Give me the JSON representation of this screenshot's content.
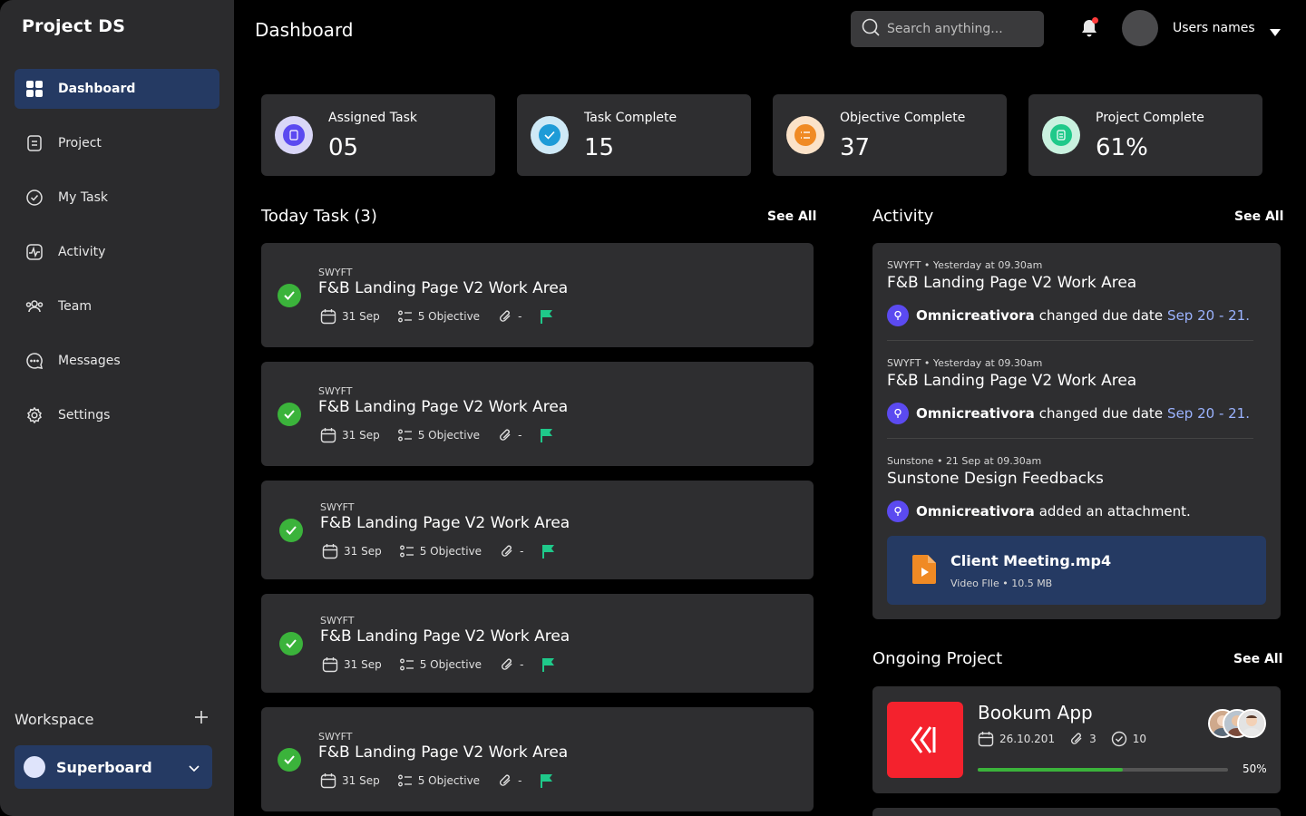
{
  "sidebar": {
    "brand": "Project DS",
    "items": [
      {
        "label": "Dashboard",
        "icon": "grid-icon"
      },
      {
        "label": "Project",
        "icon": "document-icon"
      },
      {
        "label": "My Task",
        "icon": "check-circle-icon"
      },
      {
        "label": "Activity",
        "icon": "activity-icon"
      },
      {
        "label": "Team",
        "icon": "team-icon"
      },
      {
        "label": "Messages",
        "icon": "chat-icon"
      },
      {
        "label": "Settings",
        "icon": "gear-icon"
      }
    ],
    "workspace_label": "Workspace",
    "workspace_name": "Superboard"
  },
  "header": {
    "title": "Dashboard",
    "search_placeholder": "Search anything...",
    "user_name": "Users names"
  },
  "stats": [
    {
      "label": "Assigned Task",
      "value": "05",
      "color": "#5b4af0"
    },
    {
      "label": "Task Complete",
      "value": "15",
      "color": "#1e9bd7"
    },
    {
      "label": "Objective Complete",
      "value": "37",
      "color": "#f08a24"
    },
    {
      "label": "Project Complete",
      "value": "61%",
      "color": "#1fc98a"
    }
  ],
  "today": {
    "title": "Today Task (3)",
    "see_all": "See All",
    "tasks": [
      {
        "company": "SWYFT",
        "title": "F&B Landing Page V2 Work Area",
        "date": "31 Sep",
        "objective": "5 Objective",
        "attach": "-"
      },
      {
        "company": "SWYFT",
        "title": "F&B Landing Page V2 Work Area",
        "date": "31 Sep",
        "objective": "5 Objective",
        "attach": "-"
      },
      {
        "company": "SWYFT",
        "title": "F&B Landing Page V2 Work Area",
        "date": "31 Sep",
        "objective": "5 Objective",
        "attach": "-"
      },
      {
        "company": "SWYFT",
        "title": "F&B Landing Page V2 Work Area",
        "date": "31 Sep",
        "objective": "5 Objective",
        "attach": "-"
      },
      {
        "company": "SWYFT",
        "title": "F&B Landing Page V2 Work Area",
        "date": "31 Sep",
        "objective": "5 Objective",
        "attach": "-"
      }
    ]
  },
  "activity": {
    "title": "Activity",
    "see_all": "See All",
    "entries": [
      {
        "company": "SWYFT",
        "time": "Yesterday at 09.30am",
        "title": "F&B Landing Page V2 Work Area",
        "user": "Omnicreativora",
        "action": "changed due date",
        "date": "Sep 20 - 21."
      },
      {
        "company": "SWYFT",
        "time": "Yesterday at 09.30am",
        "title": "F&B Landing Page V2 Work Area",
        "user": "Omnicreativora",
        "action": "changed due date",
        "date": "Sep 20 - 21."
      },
      {
        "company": "Sunstone",
        "time": "21 Sep at 09.30am",
        "title": "Sunstone Design Feedbacks",
        "user": "Omnicreativora",
        "action": "added an attachment.",
        "date": ""
      }
    ],
    "file": {
      "name": "Client Meeting.mp4",
      "type": "Video FIle",
      "size": "10.5 MB"
    }
  },
  "ongoing": {
    "title": "Ongoing Project",
    "see_all": "See All",
    "project": {
      "name": "Bookum App",
      "date": "26.10.201",
      "attachments": "3",
      "tasks": "10",
      "progress_label": "50%",
      "progress": 0.58
    }
  }
}
